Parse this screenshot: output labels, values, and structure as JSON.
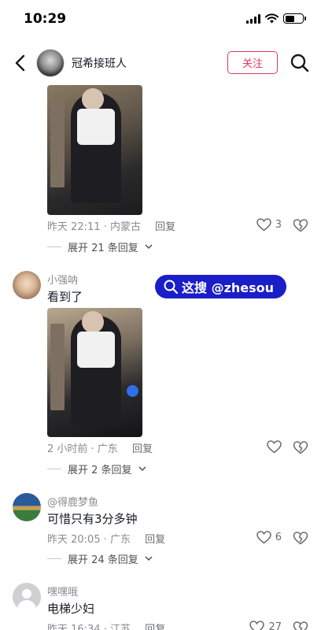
{
  "status_bar": {
    "time": "10:29"
  },
  "header": {
    "author_name": "冠希接班人",
    "follow_label": "关注"
  },
  "watermark": {
    "text": "这搜 @zhesou"
  },
  "comments": [
    {
      "time": "昨天 22:11 · 内蒙古",
      "reply_label": "回复",
      "likes": "3",
      "expand_label": "展开 21 条回复"
    },
    {
      "username": "小强呐",
      "text": "看到了",
      "time": "2 小时前 · 广东",
      "reply_label": "回复",
      "expand_label": "展开 2 条回复"
    },
    {
      "username": "@得鹿梦鱼",
      "text": "可惜只有3分多钟",
      "time": "昨天 20:05 · 广东",
      "reply_label": "回复",
      "likes": "6",
      "expand_label": "展开 24 条回复"
    },
    {
      "username": "嘿嘿哦",
      "text": "电梯少妇",
      "time": "昨天 16:34 · 江苏",
      "reply_label": "回复",
      "likes": "27"
    }
  ]
}
